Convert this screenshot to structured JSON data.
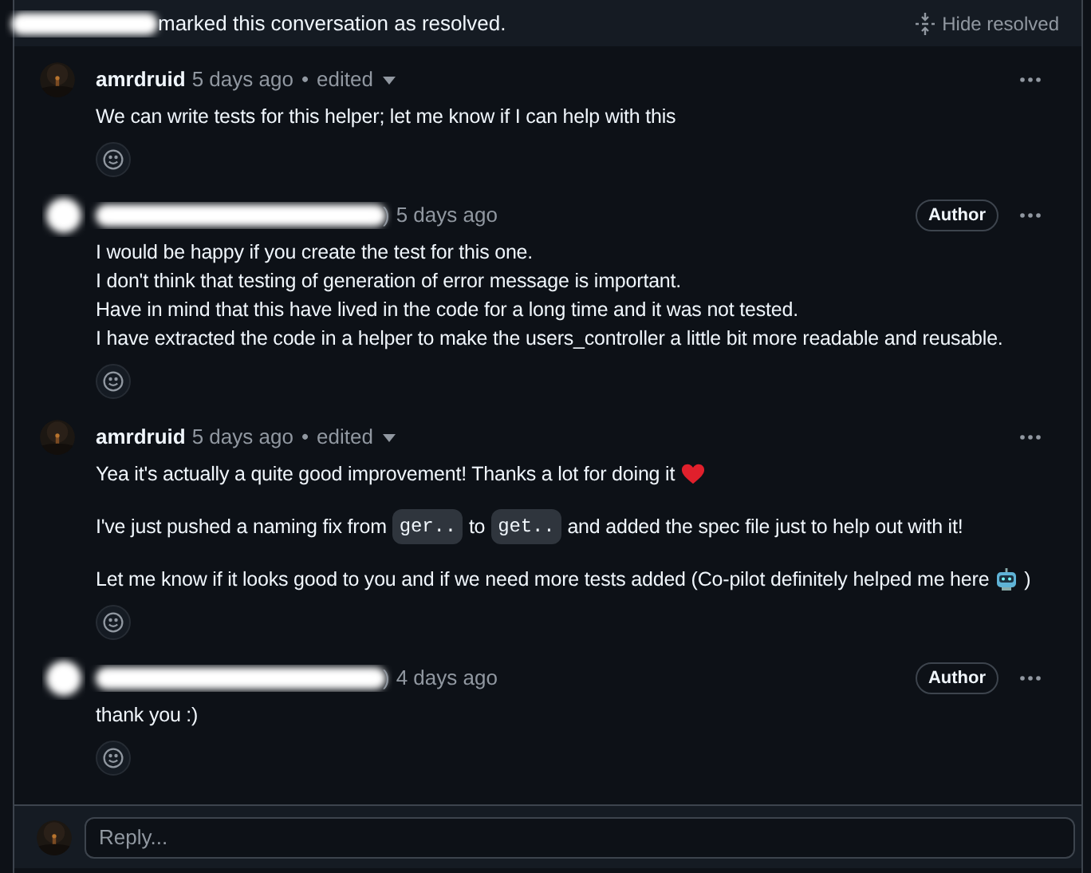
{
  "resolved_banner": {
    "text": "marked this conversation as resolved.",
    "hide_button": "Hide resolved"
  },
  "comments": [
    {
      "kind": "named",
      "author": "amrdruid",
      "time": "5 days ago",
      "separator": "•",
      "edited": "edited",
      "paragraphs": [
        [
          {
            "kind": "text",
            "text": "We can write tests for this helper; let me know if I can help with this"
          }
        ]
      ]
    },
    {
      "kind": "redacted",
      "name_tail": ")",
      "time": "5 days ago",
      "badge": "Author",
      "paragraphs": [
        [
          {
            "kind": "text",
            "text": "I would be happy if you create the test for this one."
          }
        ],
        [
          {
            "kind": "text",
            "text": "I don't think that testing of generation of error message is important."
          }
        ],
        [
          {
            "kind": "text",
            "text": "Have in mind that this have lived in the code for a long time and it was not tested."
          }
        ],
        [
          {
            "kind": "text",
            "text": "I have extracted the code in a helper to make the users_controller a little bit more readable and reusable."
          }
        ]
      ],
      "tight": true
    },
    {
      "kind": "named",
      "author": "amrdruid",
      "time": "5 days ago",
      "separator": "•",
      "edited": "edited",
      "paragraphs": [
        [
          {
            "kind": "text",
            "text": "Yea it's actually a quite good improvement! Thanks a lot for doing it"
          },
          {
            "kind": "heart"
          }
        ],
        [
          {
            "kind": "text",
            "text": "I've just pushed a naming fix from"
          },
          {
            "kind": "code",
            "text": "ger.."
          },
          {
            "kind": "text",
            "text": "to"
          },
          {
            "kind": "code",
            "text": "get.."
          },
          {
            "kind": "text",
            "text": "and added the spec file just to help out with it!"
          }
        ],
        [
          {
            "kind": "text",
            "text": "Let me know if it looks good to you and if we need more tests added (Co-pilot definitely helped me here"
          },
          {
            "kind": "robot"
          },
          {
            "kind": "text",
            "text": ")"
          }
        ]
      ],
      "tight": false
    },
    {
      "kind": "redacted",
      "name_tail": ")",
      "time": "4 days ago",
      "badge": "Author",
      "paragraphs": [
        [
          {
            "kind": "text",
            "text": "thank you :)"
          }
        ]
      ]
    }
  ],
  "reply": {
    "placeholder": "Reply..."
  }
}
